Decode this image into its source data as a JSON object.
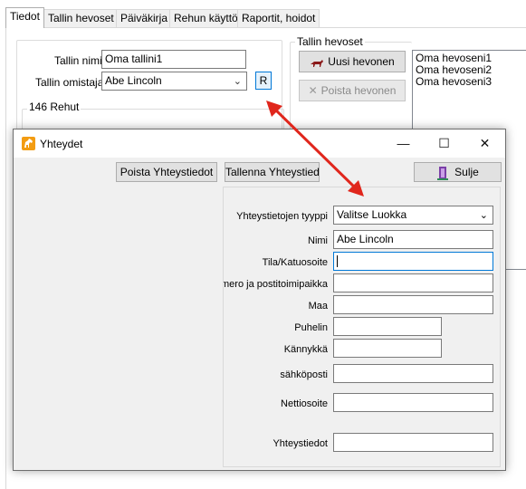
{
  "tabs": [
    "Tiedot",
    "Tallin hevoset",
    "Päiväkirja",
    "Rehun käyttö",
    "Raportit, hoidot"
  ],
  "stable": {
    "name_label": "Tallin nimi",
    "name_value": "Oma tallini1",
    "owner_label": "Tallin omistaja",
    "owner_value": "Abe Lincoln",
    "r_button": "R",
    "feed_group": "146 Rehut"
  },
  "horses": {
    "group_title": "Tallin hevoset",
    "new_button": "Uusi hevonen",
    "remove_button": "Poista hevonen",
    "list": [
      "Oma hevoseni1",
      "Oma hevoseni2",
      "Oma hevoseni3"
    ]
  },
  "dialog": {
    "title": "Yhteydet",
    "minimize": "—",
    "maximize": "☐",
    "close": "✕",
    "delete_button": "Poista Yhteystiedot",
    "save_button": "Tallenna Yhteystiedot",
    "close_button": "Sulje",
    "fields": {
      "type_label": "Yhteystietojen tyyppi",
      "type_value": "Valitse Luokka",
      "name_label": "Nimi",
      "name_value": "Abe Lincoln",
      "address_label": "Tila/Katuosoite",
      "address_value": "",
      "postal_label": "Postinumero ja postitoimipaikka",
      "postal_value": "",
      "country_label": "Maa",
      "country_value": "",
      "phone_label": "Puhelin",
      "phone_value": "",
      "mobile_label": "Kännykkä",
      "mobile_value": "",
      "email_label": "sähköposti",
      "email_value": "",
      "web_label": "Nettiosoite",
      "web_value": "",
      "contact_label": "Yhteystiedot",
      "contact_value": ""
    }
  },
  "colors": {
    "arrow": "#e0261c",
    "focus_border": "#0078d7",
    "dialog_bg": "#f0f0f0"
  }
}
